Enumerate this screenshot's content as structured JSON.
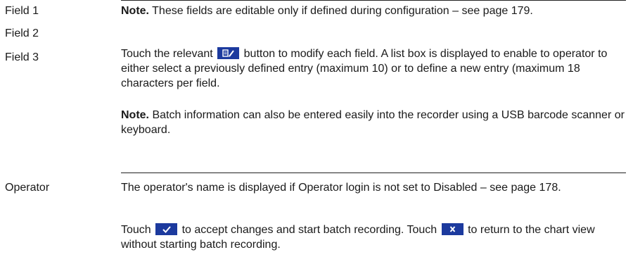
{
  "terms": {
    "field1": "Field 1",
    "field2": "Field 2",
    "field3": "Field 3",
    "operator": "Operator"
  },
  "fields_section": {
    "note1_label": "Note.",
    "note1_text": " These fields are editable only if defined during configuration – see page 179.",
    "touch_pre": "Touch the relevant ",
    "touch_post": " button to modify each field. A list box is displayed to enable to operator to either select a previously defined entry (maximum 10) or to define a new entry (maximum 18 characters per field.",
    "note2_label": "Note.",
    "note2_text": " Batch information can also be entered easily into the recorder using a USB barcode scanner or keyboard."
  },
  "operator_section": {
    "p1_pre": "The operator's name is displayed if ",
    "p1_setting": "Operator login",
    "p1_mid": " is not set to ",
    "p1_value": "Disabled",
    "p1_post": " – see page 178.",
    "p2_pre": "Touch ",
    "p2_mid": " to accept changes and start batch recording. Touch ",
    "p2_post": " to return to the chart view without starting batch recording."
  },
  "icons": {
    "edit": "edit-icon",
    "accept": "checkmark-icon",
    "cancel": "close-icon"
  },
  "colors": {
    "button_blue": "#1c3a9e",
    "text": "#1a1a1a"
  }
}
